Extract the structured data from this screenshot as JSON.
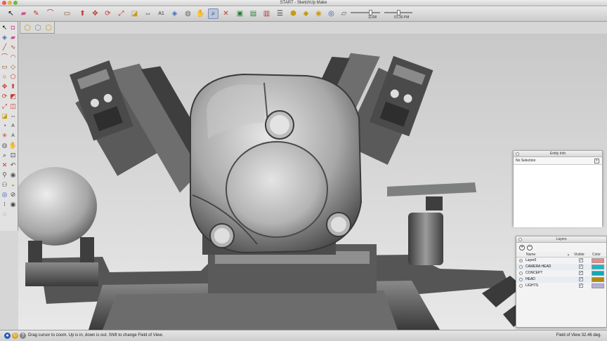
{
  "window": {
    "title": "START - SketchUp Make"
  },
  "toolbar": {
    "shadow_date": "11/08",
    "shadow_time": "01:30 PM",
    "tools": [
      "select-icon",
      "eraser-icon",
      "pencil-icon",
      "arc-icon",
      "rectangle-icon",
      "push-pull-icon",
      "move-icon",
      "rotate-icon",
      "scale-icon",
      "tape-measure-icon",
      "text-icon",
      "paint-bucket-icon",
      "orbit-icon",
      "pan-icon",
      "zoom-icon",
      "zoom-extents-icon",
      "warehouse-icon",
      "extension-icon",
      "layer-icon",
      "component-icon",
      "style-icon",
      "section-icon",
      "shadow-icon"
    ]
  },
  "status": {
    "hint": "Drag cursor to zoom.  Up is in, down is out.  Shift to change Field of View.",
    "field_of_view": "Field of View  32.46 deg."
  },
  "entity_info": {
    "title": "Entity Info",
    "selection": "No Selection"
  },
  "layers": {
    "title": "Layers",
    "col_name": "Name",
    "col_visible": "Visible",
    "col_color": "Color",
    "items": [
      {
        "name": "Layer0",
        "visible": true,
        "active": true,
        "color": "#f08a8a"
      },
      {
        "name": "CAMERA HEAD",
        "visible": true,
        "active": false,
        "color": "#18b9c4"
      },
      {
        "name": "CONCEPT",
        "visible": true,
        "active": false,
        "color": "#14a7b5"
      },
      {
        "name": "HEAD",
        "visible": true,
        "active": false,
        "color": "#b08a12"
      },
      {
        "name": "LIGHTS",
        "visible": true,
        "active": false,
        "color": "#b5b0d6"
      }
    ]
  },
  "colors": {
    "selected_tool": "#b9c7dc",
    "check": "#2a5bb8"
  }
}
